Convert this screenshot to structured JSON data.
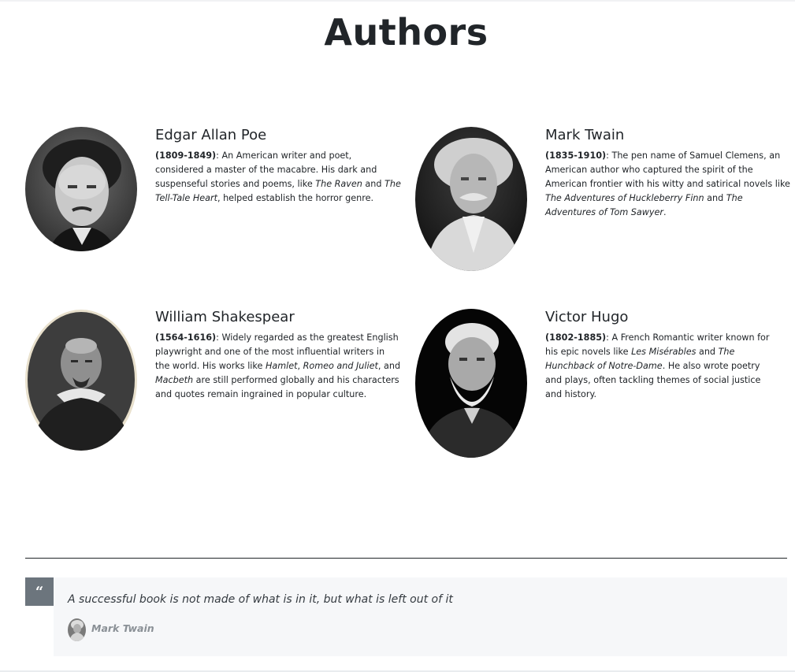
{
  "page": {
    "title": "Authors"
  },
  "authors": [
    {
      "name": "Edgar Allan Poe",
      "years": "(1809-1849)",
      "bio": [
        {
          "t": ": An American writer and poet, considered a master of the macabre. His dark and suspenseful stories and poems, like "
        },
        {
          "t": "The Raven",
          "i": true
        },
        {
          "t": " and "
        },
        {
          "t": "The Tell-Tale Heart",
          "i": true
        },
        {
          "t": ", helped establish the horror genre."
        }
      ]
    },
    {
      "name": "Mark Twain",
      "years": "(1835-1910)",
      "bio": [
        {
          "t": ": The pen name of Samuel Clemens, an American author who captured the spirit of the American frontier with his witty and satirical novels like "
        },
        {
          "t": "The Adventures of Huckleberry Finn",
          "i": true
        },
        {
          "t": " and "
        },
        {
          "t": "The Adventures of Tom Sawyer",
          "i": true
        },
        {
          "t": "."
        }
      ]
    },
    {
      "name": "William Shakespear",
      "years": "(1564-1616)",
      "bio": [
        {
          "t": ": Widely regarded as the greatest English playwright and one of the most influential writers in the world. His works like "
        },
        {
          "t": "Hamlet",
          "i": true
        },
        {
          "t": ", "
        },
        {
          "t": "Romeo and Juliet",
          "i": true
        },
        {
          "t": ", and "
        },
        {
          "t": "Macbeth",
          "i": true
        },
        {
          "t": " are still performed globally and his characters and quotes remain ingrained in popular culture."
        }
      ]
    },
    {
      "name": "Victor Hugo",
      "years": "(1802-1885)",
      "bio": [
        {
          "t": ": A French Romantic writer known for his epic novels like "
        },
        {
          "t": "Les Misérables",
          "i": true
        },
        {
          "t": " and "
        },
        {
          "t": "The Hunchback of Notre-Dame",
          "i": true
        },
        {
          "t": ". He also wrote poetry and plays, often tackling themes of social justice and history."
        }
      ]
    }
  ],
  "quote": {
    "icon": "quote-left-icon",
    "text": "A successful book is not made of what is in it, but what is left out of it",
    "author": "Mark Twain"
  },
  "colors": {
    "quote_icon_bg": "#6c757d",
    "quote_box_bg": "#f6f7f9",
    "quote_author": "#8a9096"
  }
}
